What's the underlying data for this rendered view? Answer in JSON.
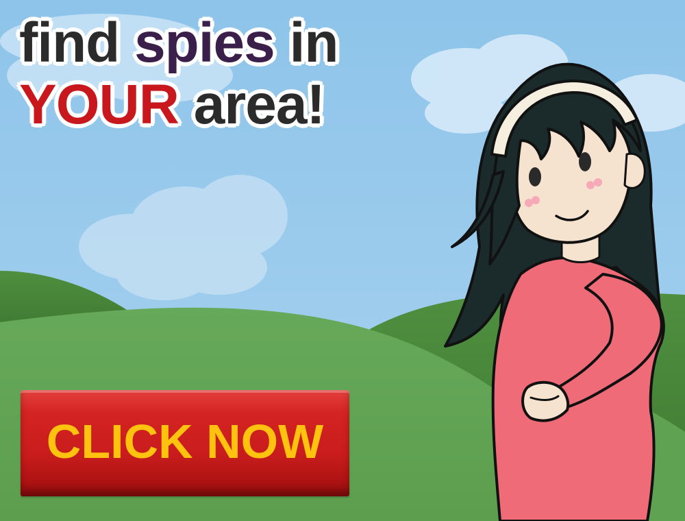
{
  "headline": {
    "line1": [
      {
        "text": "find",
        "color": "#2b2b2b"
      },
      {
        "text": "spies",
        "color": "#3a1f4a"
      },
      {
        "text": "in",
        "color": "#2b2b2b"
      }
    ],
    "line2": [
      {
        "text": "YOUR",
        "color": "#c8181e"
      },
      {
        "text": "area!",
        "color": "#2b2b2b"
      }
    ]
  },
  "cta": {
    "label": "CLICK NOW",
    "background": "#c91c1c",
    "text_color": "#ffc20f"
  },
  "scene": {
    "sky_color": "#8cc2e8",
    "hill_color": "#5fa252",
    "dress_color": "#ef6b78",
    "hair_color": "#1b2b2b",
    "headband_color": "#f6efdf"
  }
}
